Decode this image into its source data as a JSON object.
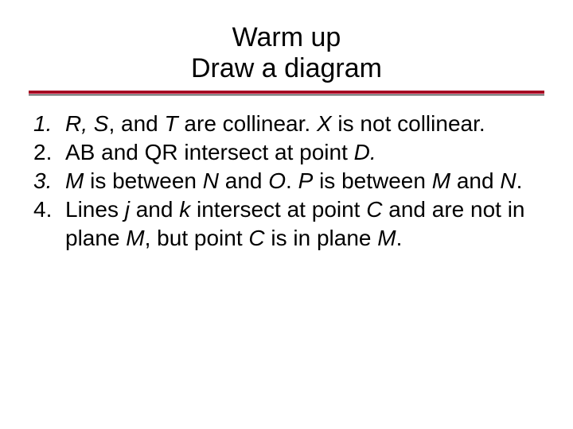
{
  "title": {
    "line1": "Warm up",
    "line2": "Draw a diagram"
  },
  "items": [
    {
      "num": "1.",
      "italic_num": true,
      "segments": [
        {
          "t": "R, S",
          "i": true
        },
        {
          "t": ", and ",
          "i": false
        },
        {
          "t": "T",
          "i": true
        },
        {
          "t": " are collinear. ",
          "i": false
        },
        {
          "t": "X",
          "i": true
        },
        {
          "t": " is not collinear.",
          "i": false
        }
      ]
    },
    {
      "num": "2.",
      "italic_num": false,
      "segments": [
        {
          "t": "AB and QR intersect at point ",
          "i": false
        },
        {
          "t": "D.",
          "i": true
        }
      ]
    },
    {
      "num": "3.",
      "italic_num": true,
      "segments": [
        {
          "t": "M",
          "i": true
        },
        {
          "t": " is between ",
          "i": false
        },
        {
          "t": "N",
          "i": true
        },
        {
          "t": " and ",
          "i": false
        },
        {
          "t": "O",
          "i": true
        },
        {
          "t": ". ",
          "i": false
        },
        {
          "t": "P",
          "i": true
        },
        {
          "t": " is between ",
          "i": false
        },
        {
          "t": "M",
          "i": true
        },
        {
          "t": " and ",
          "i": false
        },
        {
          "t": "N",
          "i": true
        },
        {
          "t": ".",
          "i": false
        }
      ]
    },
    {
      "num": "4.",
      "italic_num": false,
      "segments": [
        {
          "t": "Lines ",
          "i": false
        },
        {
          "t": "j",
          "i": true
        },
        {
          "t": " and ",
          "i": false
        },
        {
          "t": "k",
          "i": true
        },
        {
          "t": " intersect at point ",
          "i": false
        },
        {
          "t": "C",
          "i": true
        },
        {
          "t": " and are not in plane ",
          "i": false
        },
        {
          "t": "M",
          "i": true
        },
        {
          "t": ", but point ",
          "i": false
        },
        {
          "t": "C",
          "i": true
        },
        {
          "t": " is in plane ",
          "i": false
        },
        {
          "t": "M",
          "i": true
        },
        {
          "t": ".",
          "i": false
        }
      ]
    }
  ]
}
